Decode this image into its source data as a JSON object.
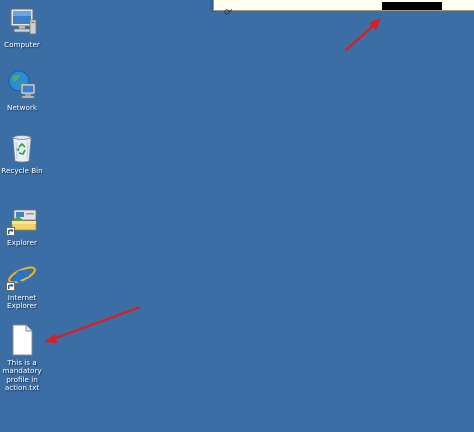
{
  "desktop": {
    "background_color": "#3a6ea5",
    "icons": [
      {
        "label": "Computer",
        "icon": "computer-icon"
      },
      {
        "label": "Network",
        "icon": "network-icon"
      },
      {
        "label": "Recycle Bin",
        "icon": "recycle-bin-icon"
      },
      {
        "label": "Explorer",
        "icon": "explorer-icon"
      },
      {
        "label": "Internet\nExplorer",
        "icon": "internet-explorer-icon"
      },
      {
        "label": "This is a\nmandatory\nprofile in\naction.txt",
        "icon": "text-file-icon"
      }
    ]
  },
  "topbar": {
    "icon": "pin-icon",
    "redacted_color": "#000000",
    "background_color": "#fffff0"
  },
  "annotations": {
    "arrow_color": "#e01b1b",
    "arrows": [
      "arrow-to-topbar",
      "arrow-to-text-file"
    ]
  }
}
